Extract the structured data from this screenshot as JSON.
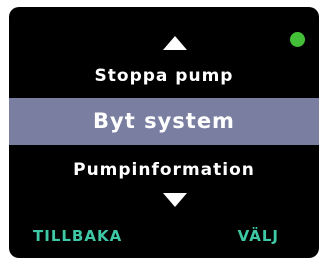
{
  "status": {
    "indicator_color": "#43c038",
    "icon": "status-dot"
  },
  "menu": {
    "scroll_up_icon": "triangle-up",
    "previous_item": "Stoppa pump",
    "selected_item": "Byt system",
    "next_item": "Pumpinformation",
    "scroll_down_icon": "triangle-down",
    "highlight_color": "#7a7fa1"
  },
  "softkeys": {
    "left_label": "TILLBAKA",
    "right_label": "VÄLJ",
    "color": "#3fc8a6"
  }
}
